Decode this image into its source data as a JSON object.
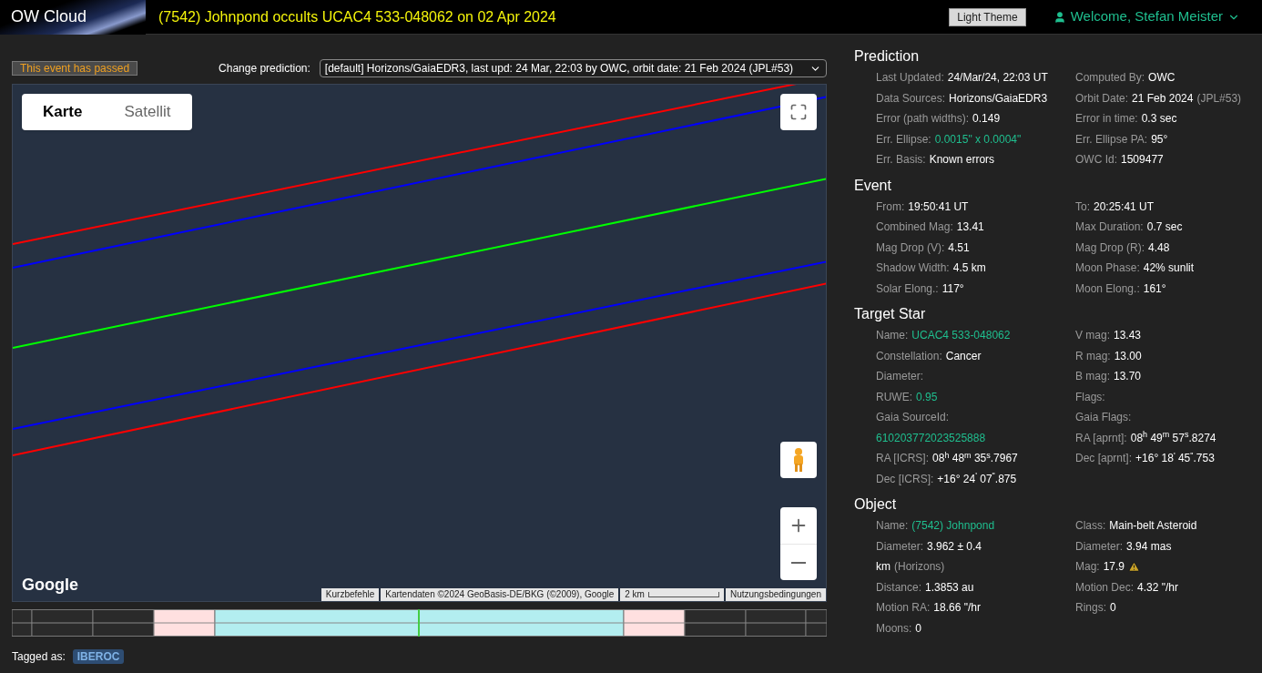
{
  "header": {
    "logo": "OW Cloud",
    "title": "(7542) Johnpond occults UCAC4 533-048062 on 02 Apr 2024",
    "theme_button": "Light Theme",
    "user": "Welcome, Stefan Meister"
  },
  "status_badge": "This event has passed",
  "prediction_select": {
    "label": "Change prediction:",
    "value": "[default] Horizons/GaiaEDR3, last upd: 24 Mar, 22:03 by OWC, orbit date: 21 Feb 2024 (JPL#53)"
  },
  "map": {
    "tabs": [
      {
        "label": "Karte",
        "selected": true
      },
      {
        "label": "Satellit",
        "selected": false
      }
    ],
    "logo": "Google",
    "attribution": [
      "Kurzbefehle",
      "Kartendaten ©2024 GeoBasis-DE/BKG (©2009), Google"
    ],
    "scale": "2 km",
    "terms": "Nutzungsbedingungen"
  },
  "tags": {
    "label": "Tagged as:",
    "items": [
      "IBEROC"
    ]
  },
  "sections": [
    {
      "title": "Prediction",
      "left": [
        {
          "label": "Last Updated:",
          "value": "24/Mar/24, 22:03 UT"
        },
        {
          "label": "Data Sources:",
          "value": "Horizons/GaiaEDR3"
        },
        {
          "label": "Error (path widths):",
          "value": "0.149"
        },
        {
          "label": "Err. Ellipse:",
          "value": "0.0015\" x 0.0004\"",
          "link": true
        },
        {
          "label": "Err. Basis:",
          "value": "Known errors"
        }
      ],
      "right": [
        {
          "label": "Computed By:",
          "value": "OWC"
        },
        {
          "label": "Orbit Date:",
          "value": "21 Feb 2024",
          "note": "(JPL#53)"
        },
        {
          "label": "Error in time:",
          "value": "0.3 sec"
        },
        {
          "label": "Err. Ellipse PA:",
          "value": "95°"
        },
        {
          "label": "OWC Id:",
          "value": "1509477"
        }
      ]
    },
    {
      "title": "Event",
      "left": [
        {
          "label": "From:",
          "value": "19:50:41 UT"
        },
        {
          "label": "Combined Mag:",
          "value": "13.41"
        },
        {
          "label": "Mag Drop (V):",
          "value": "4.51"
        },
        {
          "label": "Shadow Width:",
          "value": "4.5 km"
        },
        {
          "label": "Solar Elong.:",
          "value": "117°"
        }
      ],
      "right": [
        {
          "label": "To:",
          "value": "20:25:41 UT"
        },
        {
          "label": "Max Duration:",
          "value": "0.7 sec"
        },
        {
          "label": "Mag Drop (R):",
          "value": "4.48"
        },
        {
          "label": "Moon Phase:",
          "value": "42% sunlit"
        },
        {
          "label": "Moon Elong.:",
          "value": "161°"
        }
      ]
    },
    {
      "title": "Target Star",
      "left": [
        {
          "label": "Name:",
          "value": "UCAC4 533-048062",
          "link": true
        },
        {
          "label": "Constellation:",
          "value": "Cancer"
        },
        {
          "label": "Diameter:"
        },
        {
          "label": "RUWE:",
          "value": "0.95",
          "link": true
        },
        {
          "label": "Gaia SourceId:",
          "value_below": "610203772023525888",
          "link": true
        },
        {
          "label": "RA [ICRS]:",
          "value": "08$^{h}$ 48$^{m}$ 35$^{s}$.7967"
        },
        {
          "label": "Dec [ICRS]:",
          "value": "+16° 24$^{'}$ 07$^{\"}$.875"
        }
      ],
      "right": [
        {
          "label": "V mag:",
          "value": "13.43"
        },
        {
          "label": "R mag:",
          "value": "13.00"
        },
        {
          "label": "B mag:",
          "value": "13.70"
        },
        {
          "label": "Flags:"
        },
        {
          "label": "Gaia Flags:"
        },
        {
          "label": "RA [aprnt]:",
          "value": "08$^{h}$ 49$^{m}$ 57$^{s}$.8274"
        },
        {
          "label": "Dec [aprnt]:",
          "value": "+16° 18$^{'}$ 45$^{\"}$.753"
        }
      ]
    },
    {
      "title": "Object",
      "left": [
        {
          "label": "Name:",
          "value": "(7542) Johnpond",
          "link": true
        },
        {
          "label": "Diameter:",
          "value": "3.962 ± 0.4",
          "value_below": "km",
          "note": "(Horizons)"
        },
        {
          "label": "Distance:",
          "value": "1.3853 au"
        },
        {
          "label": "Motion RA:",
          "value": "18.66 \"/hr"
        },
        {
          "label": "Moons:",
          "value": "0"
        }
      ],
      "right": [
        {
          "label": "Class:",
          "value": "Main-belt Asteroid"
        },
        {
          "label": "Diameter:",
          "value": "3.94 mas"
        },
        {
          "label": "Mag:",
          "value": "17.9",
          "warning": true
        },
        {
          "label": "Motion Dec:",
          "value": "4.32 \"/hr"
        },
        {
          "label": "Rings:",
          "value": "0"
        }
      ]
    }
  ]
}
